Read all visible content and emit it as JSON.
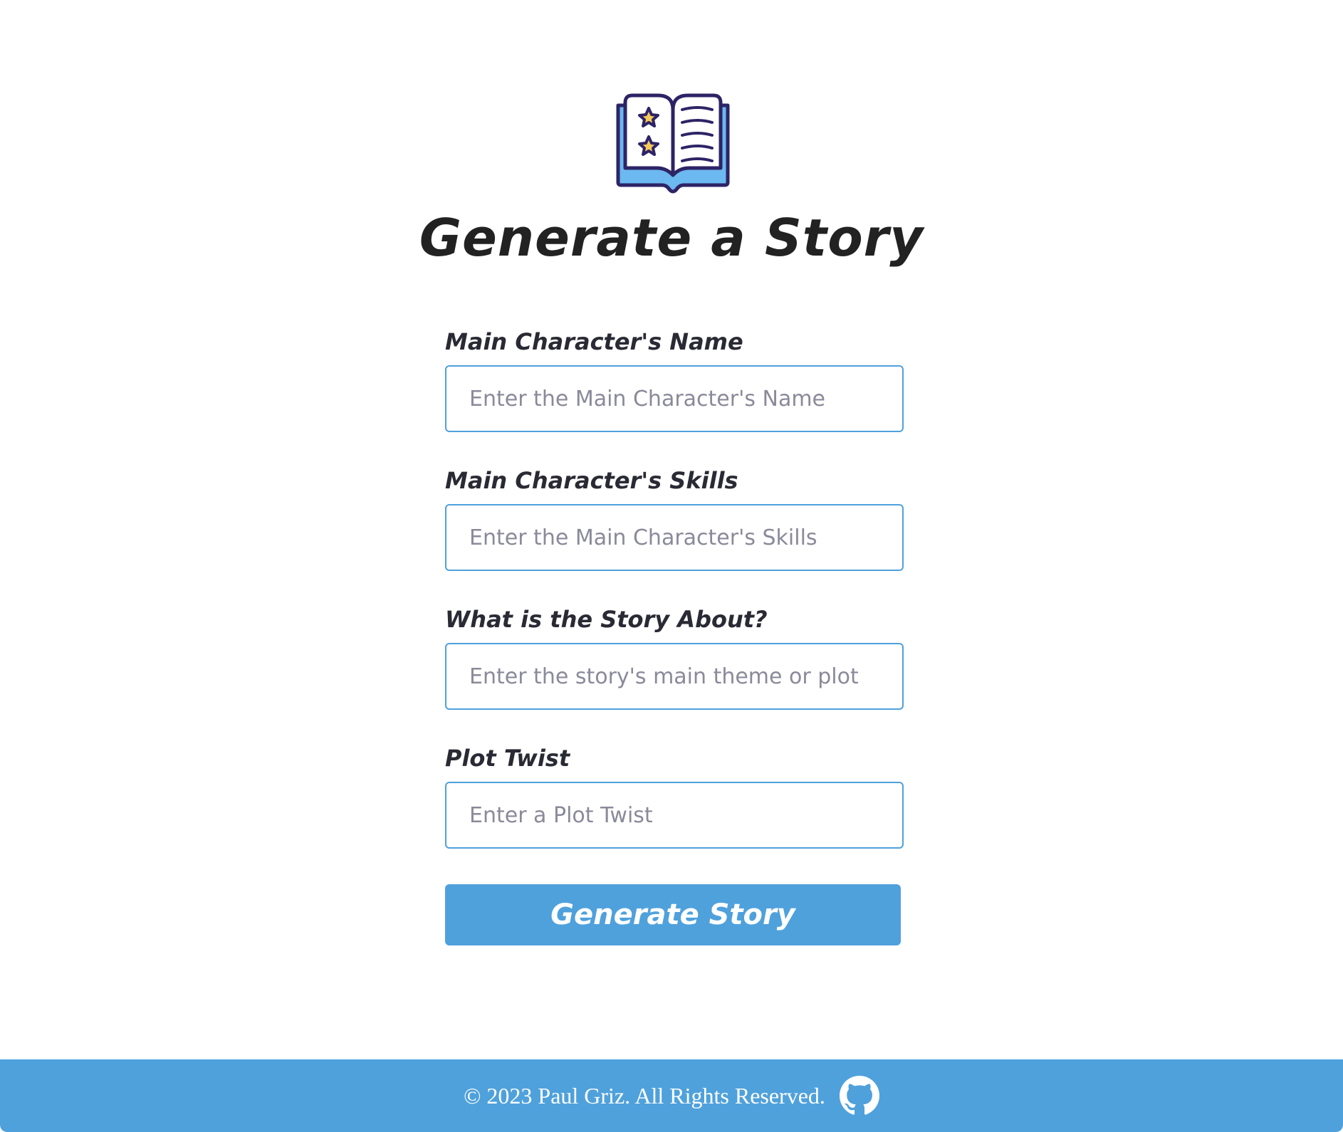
{
  "page": {
    "title": "Generate a Story",
    "logo_icon": "open-book-icon"
  },
  "form": {
    "fields": [
      {
        "label": "Main Character's Name",
        "placeholder": "Enter the Main Character's Name",
        "value": ""
      },
      {
        "label": "Main Character's Skills",
        "placeholder": "Enter the Main Character's Skills",
        "value": ""
      },
      {
        "label": "What is the Story About?",
        "placeholder": "Enter the story's main theme or plot",
        "value": ""
      },
      {
        "label": "Plot Twist",
        "placeholder": "Enter a Plot Twist",
        "value": ""
      }
    ],
    "submit_label": "Generate Story"
  },
  "footer": {
    "text": "© 2023 Paul Griz. All Rights Reserved.",
    "icon": "github-icon"
  },
  "colors": {
    "accent": "#4fa1dc",
    "text": "#222222",
    "placeholder": "#8a8a9a",
    "book_outline": "#2d2466",
    "book_blue": "#6cb8f0",
    "star_yellow": "#f5c95a"
  }
}
